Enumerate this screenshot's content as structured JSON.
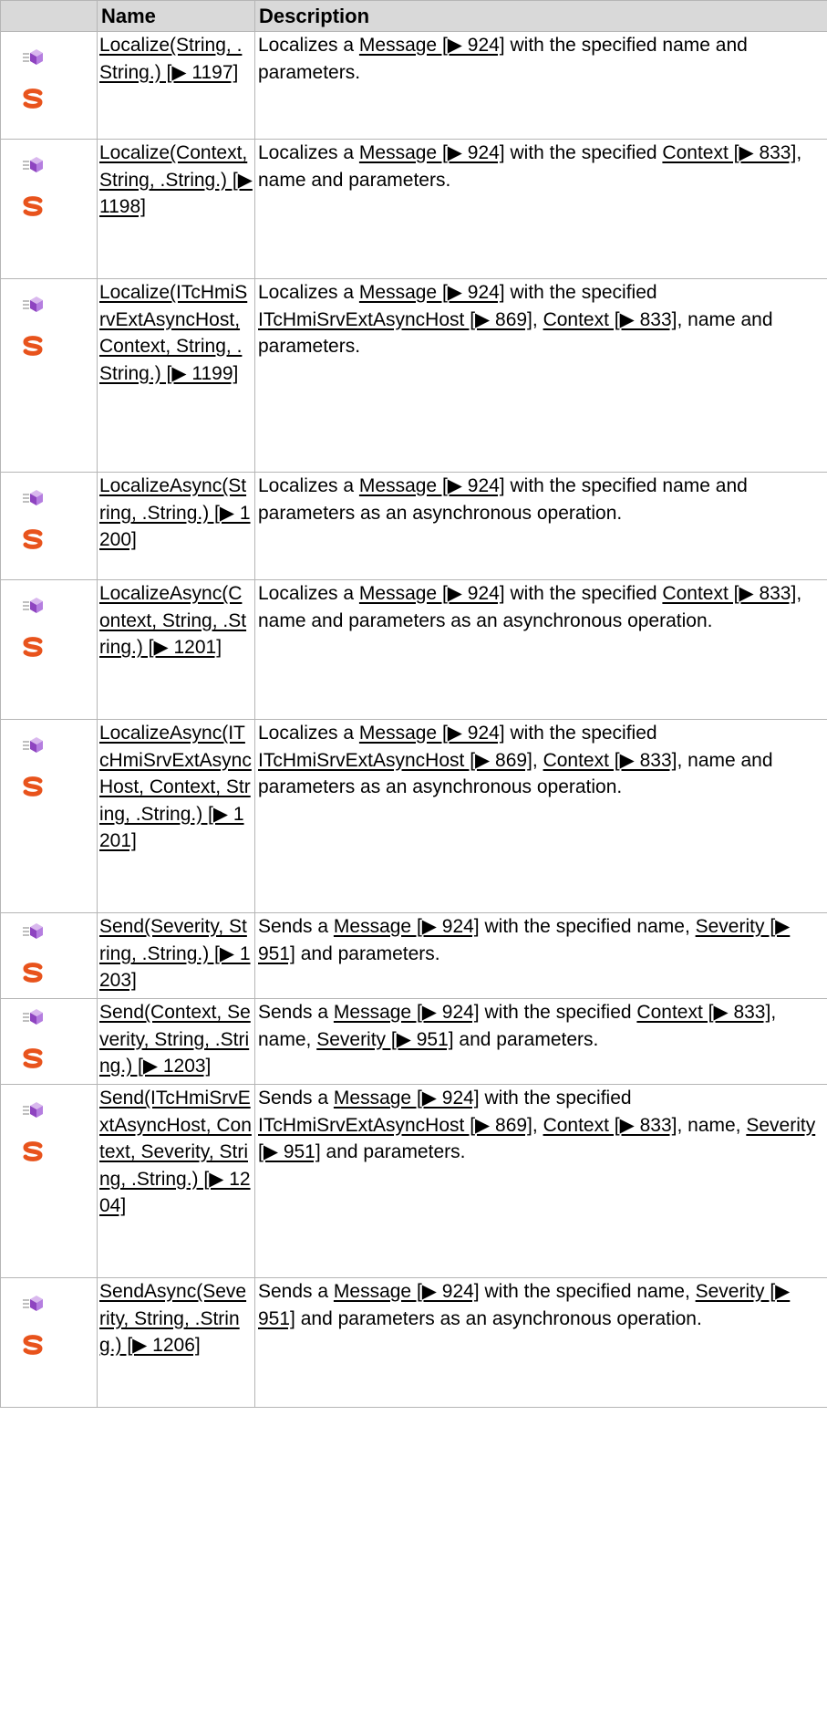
{
  "header": {
    "name": "Name",
    "description": "Description"
  },
  "rows": [
    {
      "name": "Localize(String, .String.) [▶ 1197]",
      "desc": [
        {
          "t": "Localizes a "
        },
        {
          "l": "Message [▶ 924]"
        },
        {
          "t": " with the specified name and parameters."
        }
      ]
    },
    {
      "name": "Localize(Context, String, .String.) [▶ 1198]",
      "desc": [
        {
          "t": "Localizes a "
        },
        {
          "l": "Message [▶ 924]"
        },
        {
          "t": " with the specified "
        },
        {
          "l": "Context [▶ 833]"
        },
        {
          "t": ", name and parameters."
        }
      ]
    },
    {
      "name": "Localize(ITcHmiSrvExtAsyncHost, Context, String, .String.) [▶ 1199]",
      "desc": [
        {
          "t": "Localizes a "
        },
        {
          "l": "Message [▶ 924]"
        },
        {
          "t": " with the specified "
        },
        {
          "l": "ITcHmiSrvExtAsyncHost [▶ 869]"
        },
        {
          "t": ", "
        },
        {
          "l": "Context [▶ 833]"
        },
        {
          "t": ", name and parameters."
        }
      ]
    },
    {
      "name": "LocalizeAsync(String, .String.) [▶ 1200]",
      "desc": [
        {
          "t": "Localizes a "
        },
        {
          "l": "Message [▶ 924]"
        },
        {
          "t": " with the specified name and parameters as an asynchronous operation."
        }
      ]
    },
    {
      "name": "LocalizeAsync(Context, String, .String.) [▶ 1201]",
      "desc": [
        {
          "t": "Localizes a "
        },
        {
          "l": "Message [▶ 924]"
        },
        {
          "t": " with the specified "
        },
        {
          "l": "Context [▶ 833]"
        },
        {
          "t": ", name and parameters as an asynchronous operation."
        }
      ]
    },
    {
      "name": "LocalizeAsync(ITcHmiSrvExtAsyncHost, Context, String, .String.) [▶ 1201]",
      "desc": [
        {
          "t": "Localizes a "
        },
        {
          "l": "Message [▶ 924]"
        },
        {
          "t": " with the specified "
        },
        {
          "l": "ITcHmiSrvExtAsyncHost [▶ 869]"
        },
        {
          "t": ", "
        },
        {
          "l": "Context [▶ 833]"
        },
        {
          "t": ", name and parameters as an asynchronous operation."
        }
      ]
    },
    {
      "name": "Send(Severity, String, .String.) [▶ 1203]",
      "desc": [
        {
          "t": "Sends a "
        },
        {
          "l": "Message [▶ 924]"
        },
        {
          "t": " with the specified name, "
        },
        {
          "l": "Severity [▶ 951]"
        },
        {
          "t": " and parameters."
        }
      ]
    },
    {
      "name": "Send(Context, Severity, String, .String.) [▶ 1203]",
      "desc": [
        {
          "t": "Sends a "
        },
        {
          "l": "Message [▶ 924]"
        },
        {
          "t": " with the specified "
        },
        {
          "l": "Context [▶ 833]"
        },
        {
          "t": ", name, "
        },
        {
          "l": "Severity [▶ 951]"
        },
        {
          "t": " and parameters."
        }
      ]
    },
    {
      "name": "Send(ITcHmiSrvExtAsyncHost, Context, Severity, String, .String.) [▶ 1204]",
      "desc": [
        {
          "t": "Sends a "
        },
        {
          "l": "Message [▶ 924]"
        },
        {
          "t": " with the specified "
        },
        {
          "l": "ITcHmiSrvExtAsyncHost [▶ 869]"
        },
        {
          "t": ", "
        },
        {
          "l": "Context [▶ 833]"
        },
        {
          "t": ", name, "
        },
        {
          "l": "Severity [▶ 951]"
        },
        {
          "t": " and parameters."
        }
      ]
    },
    {
      "name": "SendAsync(Severity, String, .String.) [▶ 1206]",
      "desc": [
        {
          "t": "Sends a "
        },
        {
          "l": "Message [▶ 924]"
        },
        {
          "t": " with the specified name, "
        },
        {
          "l": "Severity [▶ 951]"
        },
        {
          "t": " and parameters as an asynchronous operation."
        }
      ]
    }
  ]
}
